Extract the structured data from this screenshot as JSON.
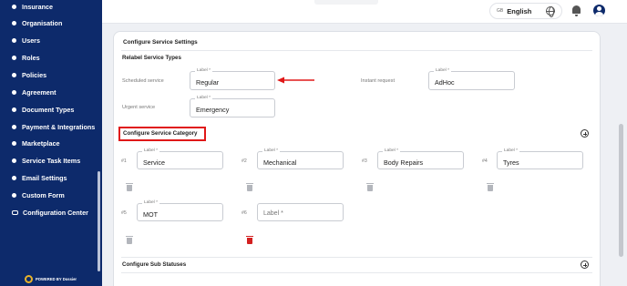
{
  "sidebar": {
    "items": [
      {
        "label": "Insurance"
      },
      {
        "label": "Organisation"
      },
      {
        "label": "Users"
      },
      {
        "label": "Roles"
      },
      {
        "label": "Policies"
      },
      {
        "label": "Agreement"
      },
      {
        "label": "Document Types"
      },
      {
        "label": "Payment & Integrations"
      },
      {
        "label": "Marketplace"
      },
      {
        "label": "Service Task Items"
      },
      {
        "label": "Email Settings"
      },
      {
        "label": "Custom Form"
      },
      {
        "label": "Configuration Center"
      }
    ],
    "powered_by": "POWERED BY Dossier"
  },
  "topbar": {
    "language_code": "GB",
    "language": "English",
    "icons": [
      "globe-icon",
      "bell-icon",
      "account-icon"
    ]
  },
  "card": {
    "title": "Configure Service Settings",
    "relabel": {
      "title": "Relabel Service Types",
      "scheduled_label": "Scheduled service",
      "instant_label": "Instant request",
      "urgent_label": "Urgent service",
      "field_label": "Label *",
      "scheduled_value": "Regular",
      "instant_value": "AdHoc",
      "urgent_value": "Emergency"
    },
    "category": {
      "title": "Configure Service Category",
      "field_label": "Label *",
      "placeholder": "Label *",
      "items": [
        {
          "num": "#1",
          "value": "Service"
        },
        {
          "num": "#2",
          "value": "Mechanical"
        },
        {
          "num": "#3",
          "value": "Body Repairs"
        },
        {
          "num": "#4",
          "value": "Tyres"
        },
        {
          "num": "#5",
          "value": "MOT"
        },
        {
          "num": "#6",
          "value": ""
        }
      ]
    },
    "sub_statuses": {
      "title": "Configure Sub Statuses"
    }
  },
  "colors": {
    "sidebar_bg": "#0d2a6b",
    "highlight": "#e01818",
    "delete_active": "#d32020"
  }
}
